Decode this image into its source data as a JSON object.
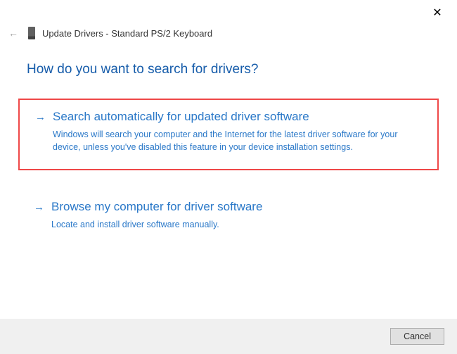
{
  "titlebar": {
    "close_glyph": "✕"
  },
  "header": {
    "back_glyph": "←",
    "title": "Update Drivers - Standard PS/2 Keyboard"
  },
  "heading": "How do you want to search for drivers?",
  "options": {
    "arrow_glyph": "→",
    "auto": {
      "title": "Search automatically for updated driver software",
      "description": "Windows will search your computer and the Internet for the latest driver software for your device, unless you've disabled this feature in your device installation settings."
    },
    "browse": {
      "title": "Browse my computer for driver software",
      "description": "Locate and install driver software manually."
    }
  },
  "footer": {
    "cancel_label": "Cancel"
  },
  "colors": {
    "accent": "#2a78c8",
    "highlight_border": "#ef4848"
  }
}
